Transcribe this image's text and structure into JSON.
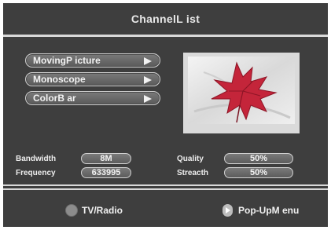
{
  "header": {
    "title": "ChannelL ist"
  },
  "menu": {
    "items": [
      {
        "label": "MovingP icture"
      },
      {
        "label": "Monoscope"
      },
      {
        "label": "ColorB ar"
      }
    ]
  },
  "info": {
    "bandwidth_label": "Bandwidth",
    "bandwidth_value": "8M",
    "frequency_label": "Frequency",
    "frequency_value": "633995",
    "quality_label": "Quality",
    "quality_value": "50%",
    "streacth_label": "Streacth",
    "streacth_value": "50%"
  },
  "footer": {
    "tv_radio_label": "TV/Radio",
    "popup_label": "Pop-UpM enu"
  },
  "colors": {
    "background": "#3e3e3e",
    "text": "#f2f2f2",
    "leaf": "#c4253a"
  },
  "icons": [
    "circle-button-icon",
    "play-arrow-icon",
    "maple-leaf-picture"
  ]
}
